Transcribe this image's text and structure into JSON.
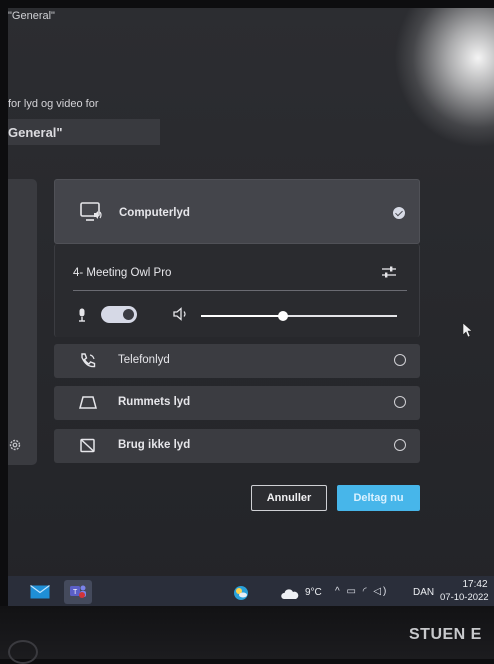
{
  "window": {
    "title": "\"General\""
  },
  "header": {
    "subtitle": "for lyd og video for",
    "channel": "General\""
  },
  "audio_options": {
    "computer": {
      "label": "Computerlyd",
      "selected": true,
      "icon": "computer-audio-icon"
    },
    "device": {
      "name": "4- Meeting Owl Pro",
      "mic_on": true,
      "volume": 0.42
    },
    "phone": {
      "label": "Telefonlyd",
      "selected": false,
      "icon": "phone-audio-icon"
    },
    "room": {
      "label": "Rummets lyd",
      "selected": false,
      "icon": "room-audio-icon"
    },
    "none": {
      "label": "Brug ikke lyd",
      "selected": false,
      "icon": "no-audio-icon"
    }
  },
  "actions": {
    "cancel": "Annuller",
    "join": "Deltag nu"
  },
  "taskbar": {
    "temperature": "9°C",
    "language": "DAN",
    "time": "17:42",
    "date": "07-10-2022",
    "tray": "^ ▭ ◜ ◁)"
  },
  "monitor": {
    "label": "STUEN E"
  },
  "colors": {
    "accent": "#47b6ea",
    "surface": "#3b3c41",
    "background": "#2c2d31"
  }
}
